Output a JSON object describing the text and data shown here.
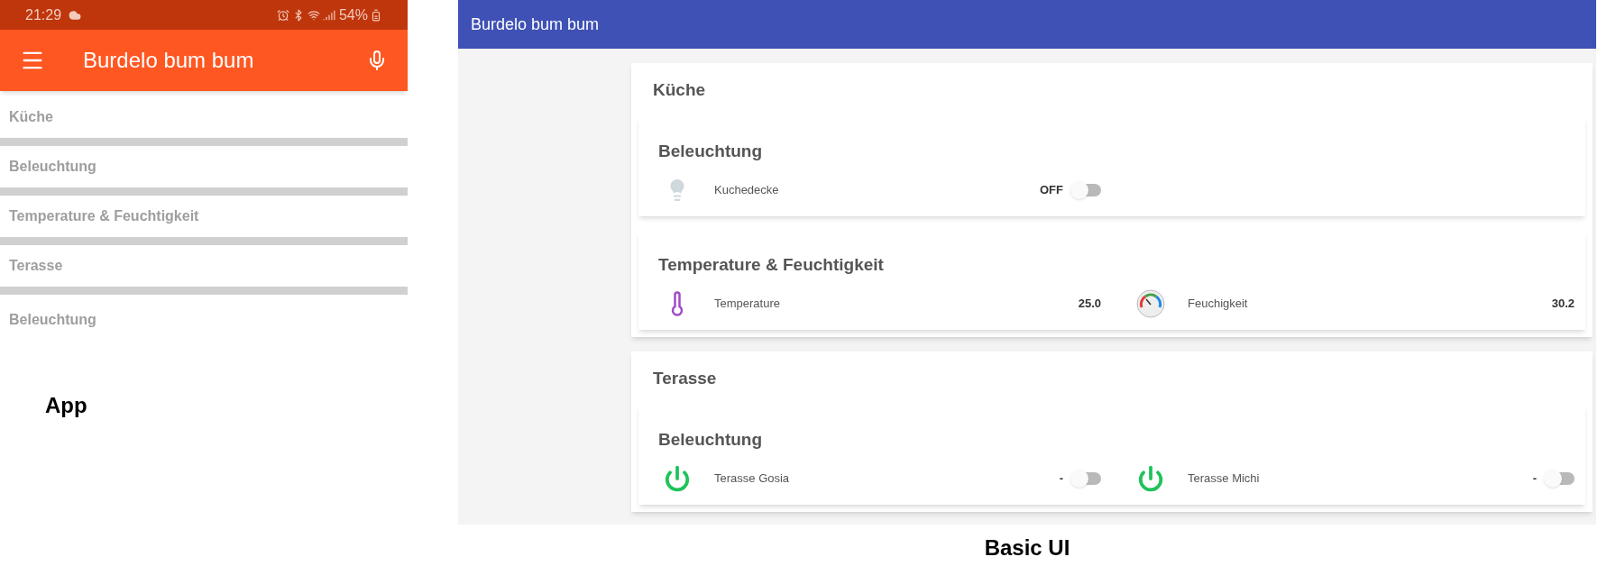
{
  "phone": {
    "status_bar": {
      "time": "21:29",
      "battery": "54%"
    },
    "app_bar": {
      "title": "Burdelo bum bum"
    },
    "items": [
      {
        "label": "Küche"
      },
      {
        "label": "Beleuchtung"
      },
      {
        "label": "Temperature & Feuchtigkeit"
      },
      {
        "label": "Terasse"
      },
      {
        "label": "Beleuchtung"
      }
    ]
  },
  "phone_caption": "App",
  "basic_ui": {
    "header": "Burdelo bum bum",
    "sections": [
      {
        "title": "Küche",
        "cards": [
          {
            "title": "Beleuchtung",
            "items": [
              {
                "kind": "lamp",
                "label": "Kuchedecke",
                "value": "OFF",
                "on": false
              }
            ]
          },
          {
            "title": "Temperature & Feuchtigkeit",
            "items": [
              {
                "kind": "temperature",
                "label": "Temperature",
                "value": "25.0"
              },
              {
                "kind": "humidity",
                "label": "Feuchigkeit",
                "value": "30.2"
              }
            ]
          }
        ]
      },
      {
        "title": "Terasse",
        "cards": [
          {
            "title": "Beleuchtung",
            "items": [
              {
                "kind": "power",
                "label": "Terasse Gosia",
                "value": "-",
                "on": false
              },
              {
                "kind": "power",
                "label": "Terasse Michi",
                "value": "-",
                "on": false
              }
            ]
          }
        ]
      }
    ]
  },
  "basic_ui_caption": "Basic UI"
}
